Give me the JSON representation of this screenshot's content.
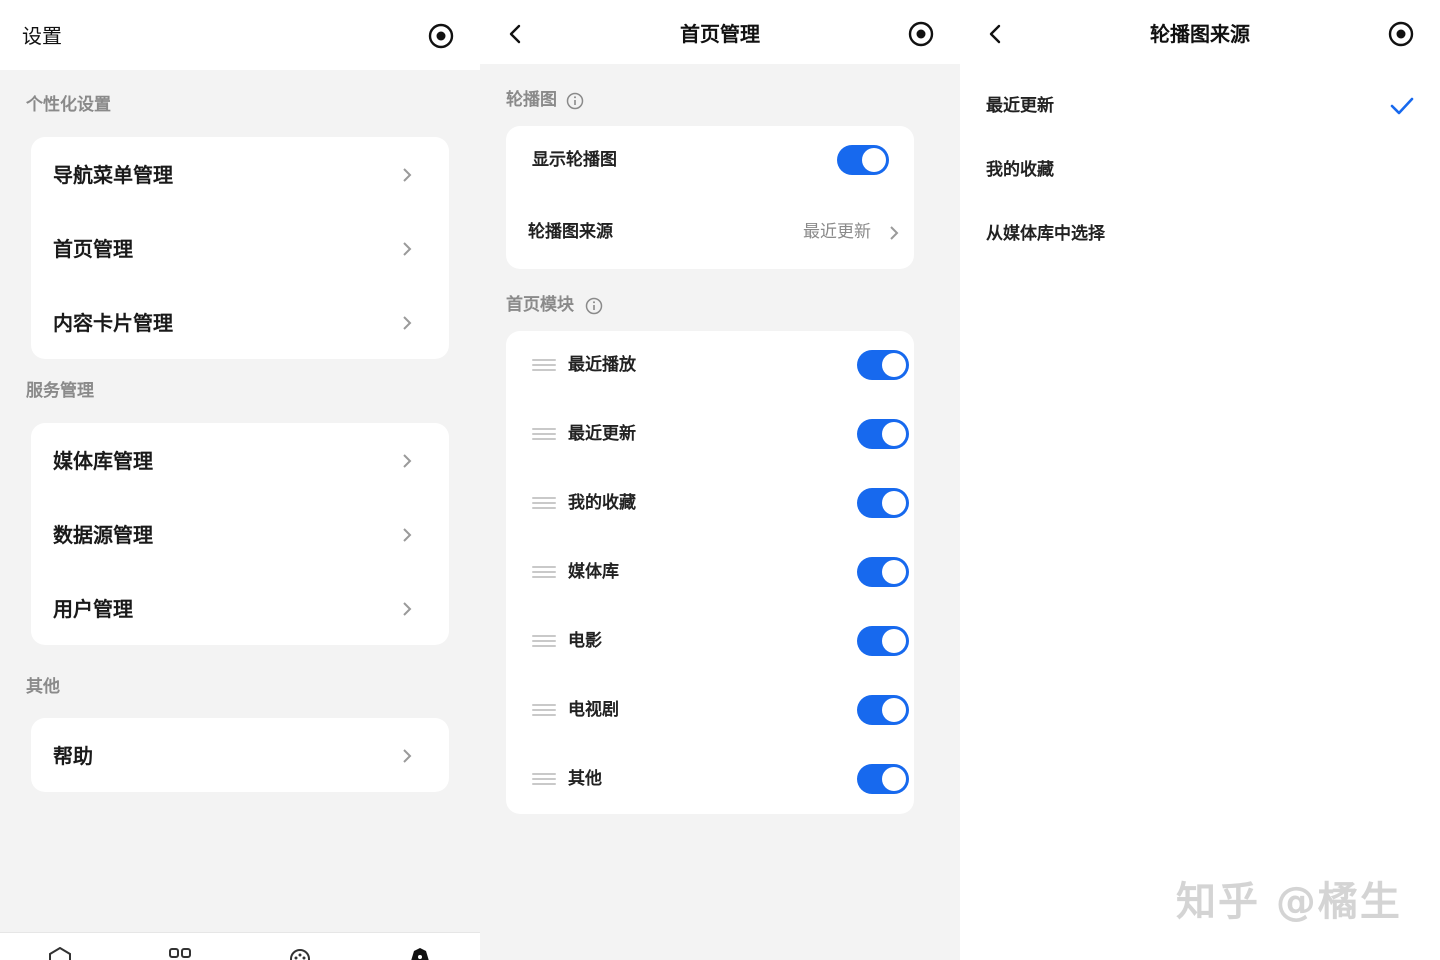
{
  "screen1": {
    "title": "设置",
    "sections": [
      {
        "label": "个性化设置",
        "items": [
          "导航菜单管理",
          "首页管理",
          "内容卡片管理"
        ]
      },
      {
        "label": "服务管理",
        "items": [
          "媒体库管理",
          "数据源管理",
          "用户管理"
        ]
      },
      {
        "label": "其他",
        "items": [
          "帮助"
        ]
      }
    ],
    "bottom_nav_icons": [
      "home-icon",
      "grid-icon",
      "discover-icon",
      "profile-icon"
    ]
  },
  "screen2": {
    "title": "首页管理",
    "carousel_section": {
      "label": "轮播图",
      "show_label": "显示轮播图",
      "show_enabled": true,
      "source_label": "轮播图来源",
      "source_value": "最近更新"
    },
    "modules_section": {
      "label": "首页模块",
      "modules": [
        {
          "label": "最近播放",
          "enabled": true
        },
        {
          "label": "最近更新",
          "enabled": true
        },
        {
          "label": "我的收藏",
          "enabled": true
        },
        {
          "label": "媒体库",
          "enabled": true
        },
        {
          "label": "电影",
          "enabled": true
        },
        {
          "label": "电视剧",
          "enabled": true
        },
        {
          "label": "其他",
          "enabled": true
        }
      ]
    }
  },
  "screen3": {
    "title": "轮播图来源",
    "options": [
      "最近更新",
      "我的收藏",
      "从媒体库中选择"
    ],
    "selected": "最近更新"
  },
  "watermark": "知乎 @橘生",
  "colors": {
    "accent": "#1769ee",
    "background": "#f3f3f3",
    "card": "#ffffff",
    "muted_text": "#8a8a8a"
  }
}
